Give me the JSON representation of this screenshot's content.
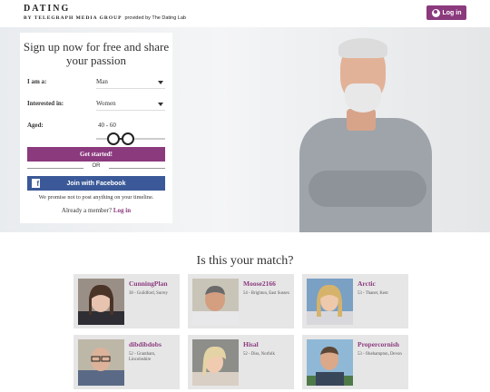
{
  "header": {
    "logo_title": "DATING",
    "logo_by": "BY TELEGRAPH MEDIA GROUP",
    "logo_provided": "provided by The Dating Lab",
    "login_label": "Log in"
  },
  "signup": {
    "title": "Sign up now for free and share your passion",
    "i_am_label": "I am a:",
    "i_am_value": "Man",
    "interested_label": "Interested in:",
    "interested_value": "Women",
    "aged_label": "Aged:",
    "aged_value": "40 - 60",
    "age_range": {
      "min": 40,
      "max": 60
    },
    "start_button": "Get started!",
    "or_text": "OR",
    "facebook_button": "Join with Facebook",
    "facebook_icon": "f",
    "promise_text": "We promise not to post anything on your timeline.",
    "member_text": "Already a member?",
    "login_link": "Log in"
  },
  "matches": {
    "title": "Is this your match?",
    "profiles": [
      {
        "name": "CunningPlan",
        "info": "38 - Guildford, Surrey"
      },
      {
        "name": "Moose2166",
        "info": "54 - Brighton, East Sussex"
      },
      {
        "name": "Arctic",
        "info": "53 - Thanet, Kent"
      },
      {
        "name": "dibdibdobs",
        "info": "52 - Grantham, Lincolnshire"
      },
      {
        "name": "Hisal",
        "info": "52 - Diss, Norfolk"
      },
      {
        "name": "Propercornish",
        "info": "53 - Okehampton, Devon"
      }
    ]
  },
  "colors": {
    "brand": "#8b3a7e",
    "facebook": "#3b5998",
    "card_bg": "#e6e6e6"
  }
}
